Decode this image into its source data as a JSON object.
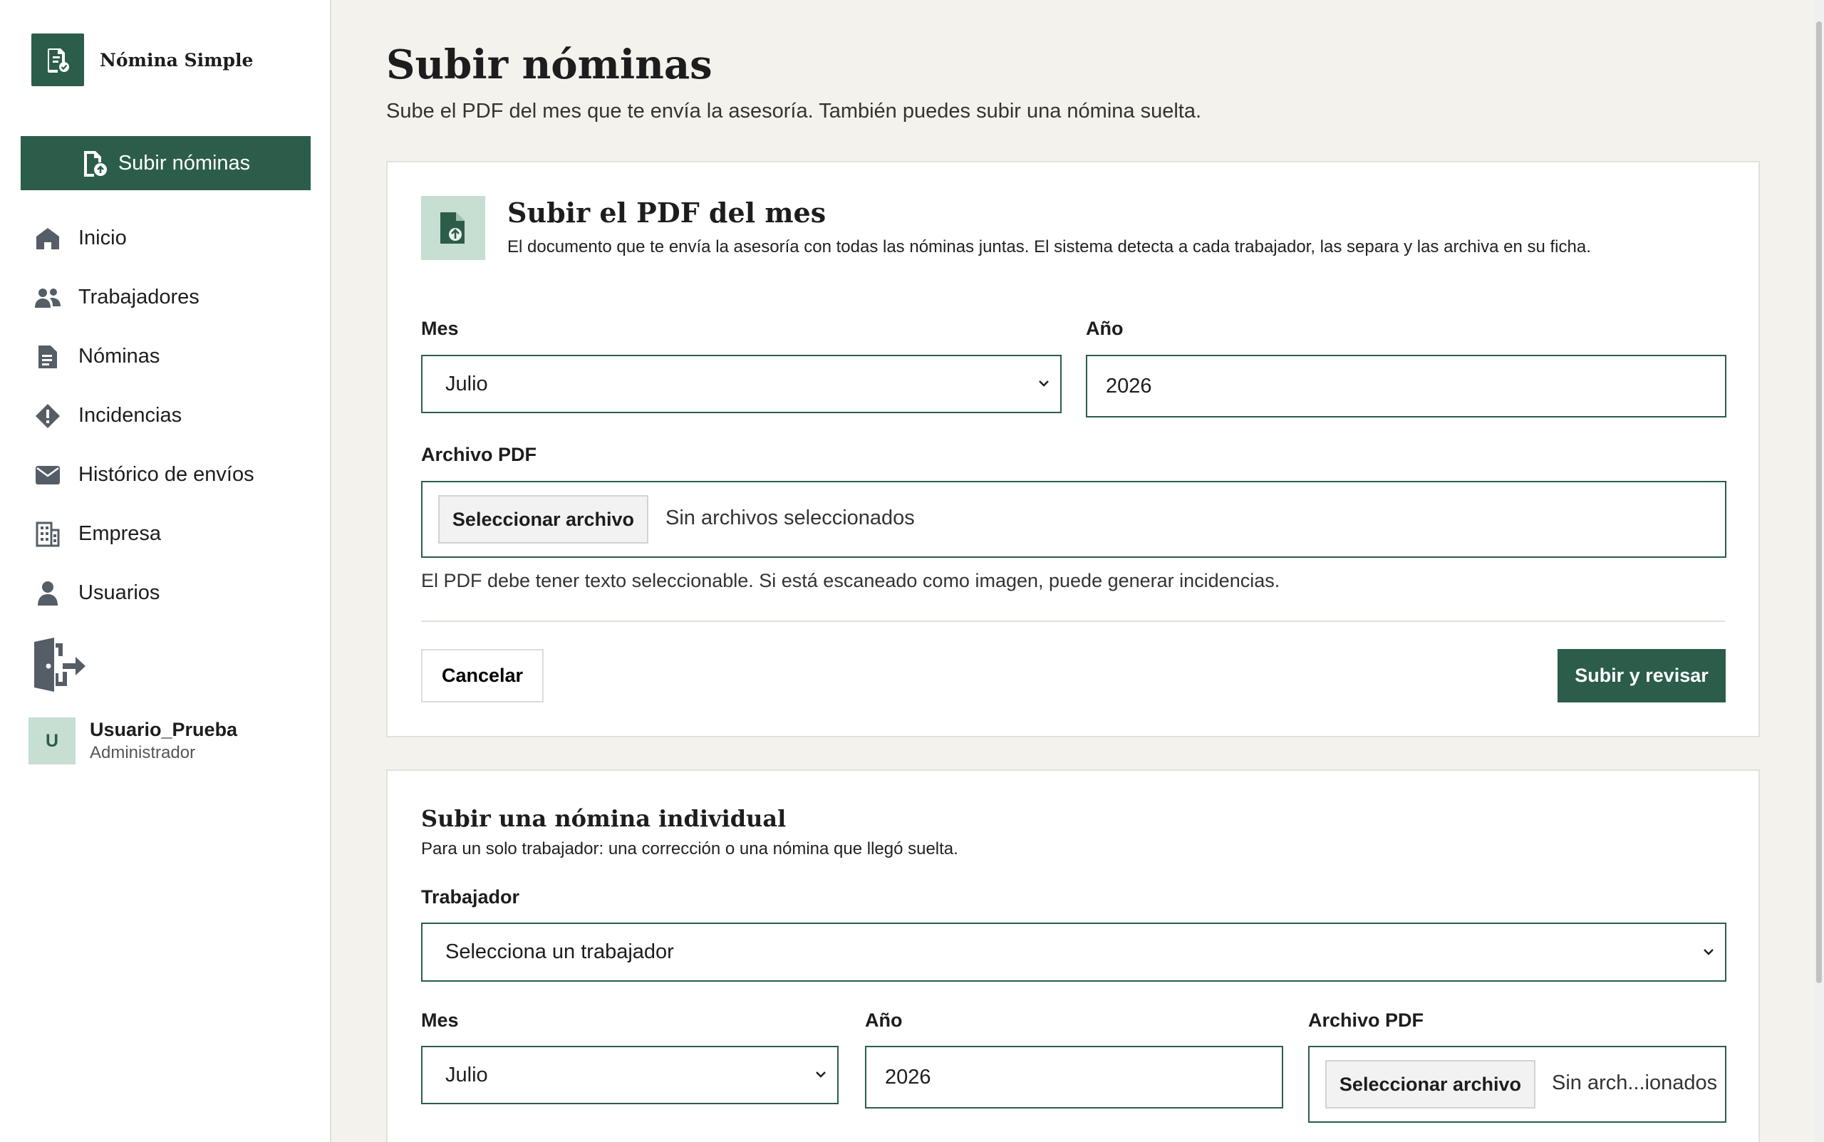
{
  "brand": {
    "name": "Nómina Simple"
  },
  "sidebar": {
    "upload_button": "Subir nóminas",
    "items": [
      {
        "label": "Inicio",
        "icon": "home-icon"
      },
      {
        "label": "Trabajadores",
        "icon": "users-icon"
      },
      {
        "label": "Nóminas",
        "icon": "document-icon"
      },
      {
        "label": "Incidencias",
        "icon": "warning-icon"
      },
      {
        "label": "Histórico de envíos",
        "icon": "mail-icon"
      },
      {
        "label": "Empresa",
        "icon": "building-icon"
      },
      {
        "label": "Usuarios",
        "icon": "user-icon"
      }
    ],
    "logout_icon": "logout-icon"
  },
  "user": {
    "initial": "U",
    "name": "Usuario_Prueba",
    "role": "Administrador"
  },
  "page": {
    "title": "Subir nóminas",
    "subtitle": "Sube el PDF del mes que te envía la asesoría. También puedes subir una nómina suelta."
  },
  "monthly": {
    "title": "Subir el PDF del mes",
    "description": "El documento que te envía la asesoría con todas las nóminas juntas. El sistema detecta a cada trabajador, las separa y las archiva en su ficha.",
    "month_label": "Mes",
    "month_value": "Julio",
    "year_label": "Año",
    "year_value": "2026",
    "file_label": "Archivo PDF",
    "file_button": "Seleccionar archivo",
    "file_status": "Sin archivos seleccionados",
    "hint": "El PDF debe tener texto seleccionable. Si está escaneado como imagen, puede generar incidencias.",
    "cancel": "Cancelar",
    "submit": "Subir y revisar"
  },
  "individual": {
    "title": "Subir una nómina individual",
    "description": "Para un solo trabajador: una corrección o una nómina que llegó suelta.",
    "worker_label": "Trabajador",
    "worker_placeholder": "Selecciona un trabajador",
    "month_label": "Mes",
    "month_value": "Julio",
    "year_label": "Año",
    "year_value": "2026",
    "file_label": "Archivo PDF",
    "file_button": "Seleccionar archivo",
    "file_status": "Sin arch...ionados"
  },
  "colors": {
    "accent": "#2b5d4a",
    "accent_light": "#c7ded3",
    "background": "#f4f2ed"
  }
}
